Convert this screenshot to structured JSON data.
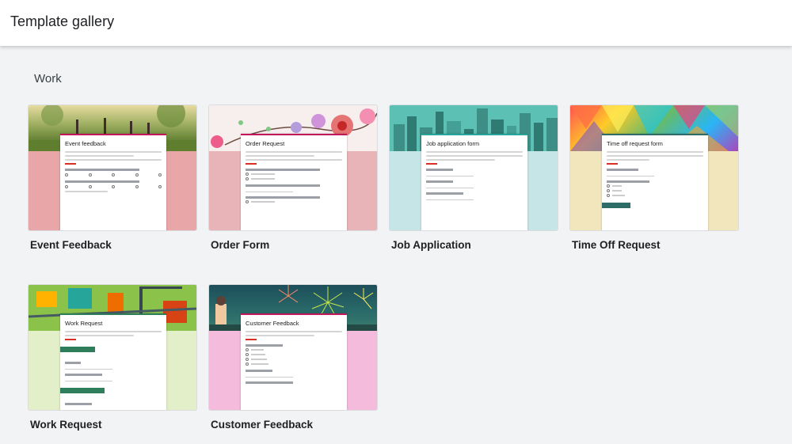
{
  "header": {
    "title": "Template gallery"
  },
  "section": {
    "title": "Work"
  },
  "templates": [
    {
      "name": "Event Feedback",
      "form_title": "Event feedback",
      "accent": "#e8a6a8"
    },
    {
      "name": "Order Form",
      "form_title": "Order Request",
      "accent": "#e9b4b7"
    },
    {
      "name": "Job Application",
      "form_title": "Job application form",
      "accent": "#c6e5e6"
    },
    {
      "name": "Time Off Request",
      "form_title": "Time off request form",
      "accent": "#f2e6bd"
    },
    {
      "name": "Work Request",
      "form_title": "Work Request",
      "accent": "#e2efc9"
    },
    {
      "name": "Customer Feedback",
      "form_title": "Customer Feedback",
      "accent": "#f4bbdc"
    }
  ]
}
